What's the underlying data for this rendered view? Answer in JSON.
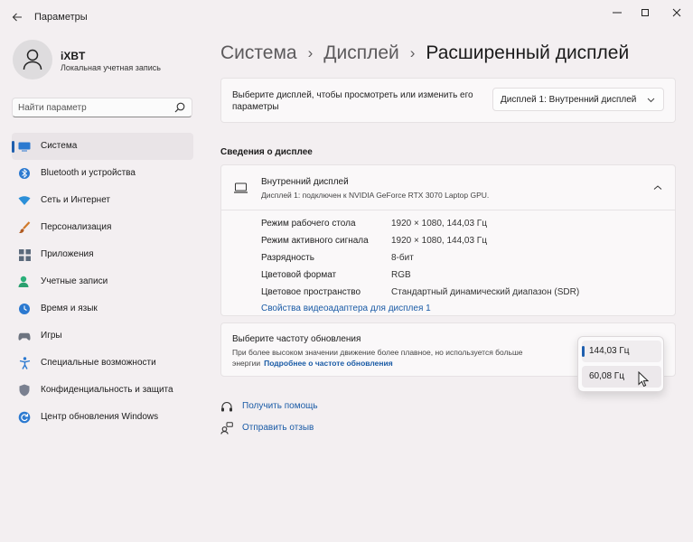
{
  "window": {
    "title": "Параметры"
  },
  "user": {
    "name": "iXBT",
    "account_type": "Локальная учетная запись"
  },
  "search": {
    "placeholder": "Найти параметр"
  },
  "nav": {
    "items": [
      {
        "label": "Система",
        "icon": "system-icon",
        "active": true
      },
      {
        "label": "Bluetooth и устройства",
        "icon": "bluetooth-icon"
      },
      {
        "label": "Сеть и Интернет",
        "icon": "wifi-icon"
      },
      {
        "label": "Персонализация",
        "icon": "brush-icon"
      },
      {
        "label": "Приложения",
        "icon": "apps-icon"
      },
      {
        "label": "Учетные записи",
        "icon": "accounts-icon"
      },
      {
        "label": "Время и язык",
        "icon": "time-language-icon"
      },
      {
        "label": "Игры",
        "icon": "gamepad-icon"
      },
      {
        "label": "Специальные возможности",
        "icon": "accessibility-icon"
      },
      {
        "label": "Конфиденциальность и защита",
        "icon": "shield-icon"
      },
      {
        "label": "Центр обновления Windows",
        "icon": "update-icon"
      }
    ]
  },
  "breadcrumb": {
    "parts": [
      "Система",
      "Дисплей"
    ],
    "current": "Расширенный дисплей"
  },
  "display_select": {
    "prompt": "Выберите дисплей, чтобы просмотреть или изменить его параметры",
    "selected": "Дисплей 1: Внутренний дисплей"
  },
  "display_info": {
    "section_title": "Сведения о дисплее",
    "name": "Внутренний дисплей",
    "subtitle": "Дисплей 1: подключен к NVIDIA GeForce RTX 3070 Laptop GPU.",
    "properties": [
      {
        "label": "Режим рабочего стола",
        "value": "1920 × 1080, 144,03 Гц"
      },
      {
        "label": "Режим активного сигнала",
        "value": "1920 × 1080, 144,03 Гц"
      },
      {
        "label": "Разрядность",
        "value": "8-бит"
      },
      {
        "label": "Цветовой формат",
        "value": "RGB"
      },
      {
        "label": "Цветовое пространство",
        "value": "Стандартный динамический диапазон (SDR)"
      }
    ],
    "adapter_link": "Свойства видеоадаптера для дисплея 1"
  },
  "refresh": {
    "title": "Выберите частоту обновления",
    "description": "При более высоком значении движение более плавное, но используется больше энергии",
    "link": "Подробнее о частоте обновления",
    "options": [
      "144,03 Гц",
      "60,08 Гц"
    ],
    "selected": "144,03 Гц"
  },
  "footer": {
    "help": "Получить помощь",
    "feedback": "Отправить отзыв"
  },
  "colors": {
    "accent": "#1f5fae",
    "link": "#1a5ba6",
    "background": "#f3eff1",
    "card": "#faf8f9"
  }
}
